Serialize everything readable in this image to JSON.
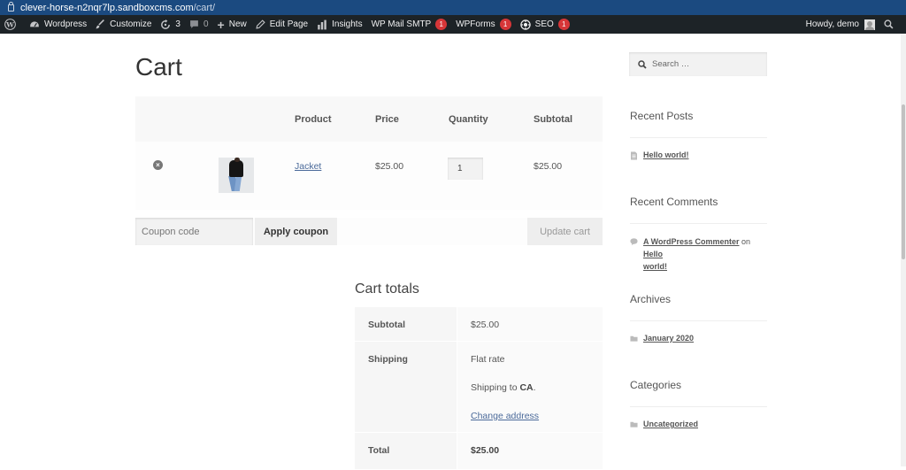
{
  "browser": {
    "url_host": "clever-horse-n2nqr7lp.sandboxcms.com",
    "url_path": "/cart/"
  },
  "admin_bar": {
    "site_name": "Wordpress",
    "customize": "Customize",
    "updates_count": "3",
    "comments_count": "0",
    "new": "New",
    "edit_page": "Edit Page",
    "insights": "Insights",
    "wp_mail_smtp": "WP Mail SMTP",
    "wp_mail_smtp_badge": "1",
    "wpforms": "WPForms",
    "wpforms_badge": "1",
    "seo": "SEO",
    "seo_badge": "1",
    "howdy": "Howdy, demo"
  },
  "page": {
    "title": "Cart"
  },
  "cart": {
    "headers": {
      "product": "Product",
      "price": "Price",
      "quantity": "Quantity",
      "subtotal": "Subtotal"
    },
    "items": [
      {
        "name": "Jacket",
        "price": "$25.00",
        "quantity": "1",
        "subtotal": "$25.00"
      }
    ],
    "coupon_placeholder": "Coupon code",
    "apply_coupon": "Apply coupon",
    "update_cart": "Update cart"
  },
  "totals": {
    "title": "Cart totals",
    "subtotal_label": "Subtotal",
    "subtotal_value": "$25.00",
    "shipping_label": "Shipping",
    "shipping_method": "Flat rate",
    "shipping_to_prefix": "Shipping to ",
    "shipping_to_region": "CA",
    "shipping_to_suffix": ".",
    "change_address": "Change address",
    "total_label": "Total",
    "total_value": "$25.00"
  },
  "sidebar": {
    "search_placeholder": "Search …",
    "recent_posts_title": "Recent Posts",
    "recent_posts": [
      "Hello world!"
    ],
    "recent_comments_title": "Recent Comments",
    "comment_author": "A WordPress Commenter",
    "comment_on": "on",
    "comment_post_line1": "Hello",
    "comment_post_line2": "world!",
    "archives_title": "Archives",
    "archives": [
      "January 2020"
    ],
    "categories_title": "Categories",
    "categories": [
      "Uncategorized"
    ]
  }
}
